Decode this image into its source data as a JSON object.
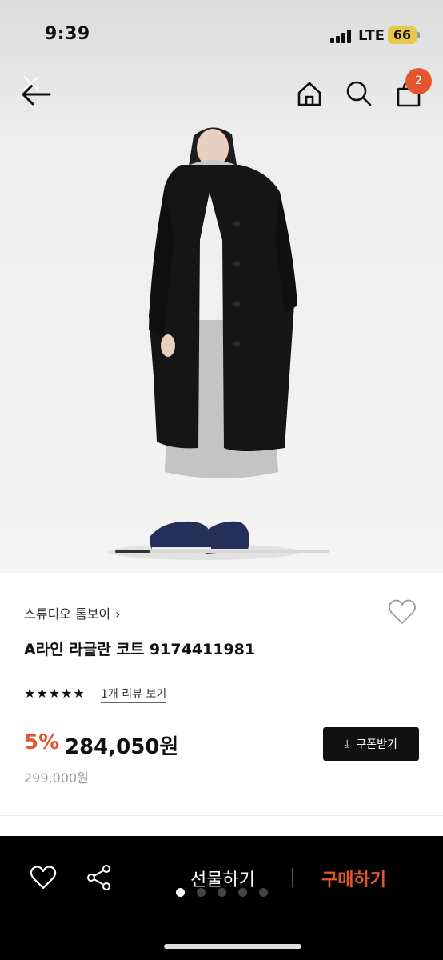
{
  "status_bar": {
    "time": "9:39",
    "network": "LTE",
    "battery": "66"
  },
  "nav": {
    "cart_count": "2"
  },
  "product": {
    "brand": "스튜디오 톰보이",
    "brand_chevron": "›",
    "title": "A라인 라글란 코트 9174411981",
    "rating_stars": "★★★★★",
    "review_link": "1개 리뷰 보기",
    "discount": "5%",
    "price": "284,050원",
    "original_price": "299,000원",
    "coupon_label": "쿠폰받기",
    "coupon_icon": "⤓"
  },
  "bottom_bar": {
    "gift_label": "선물하기",
    "buy_label": "구매하기"
  },
  "colors": {
    "accent": "#e4572e",
    "dark": "#111111",
    "bottom_bar": "#000000"
  },
  "icons": [
    "back-arrow-icon",
    "close-icon",
    "home-icon",
    "search-icon",
    "cart-icon",
    "heart-icon",
    "share-icon",
    "download-icon",
    "star-icon"
  ]
}
